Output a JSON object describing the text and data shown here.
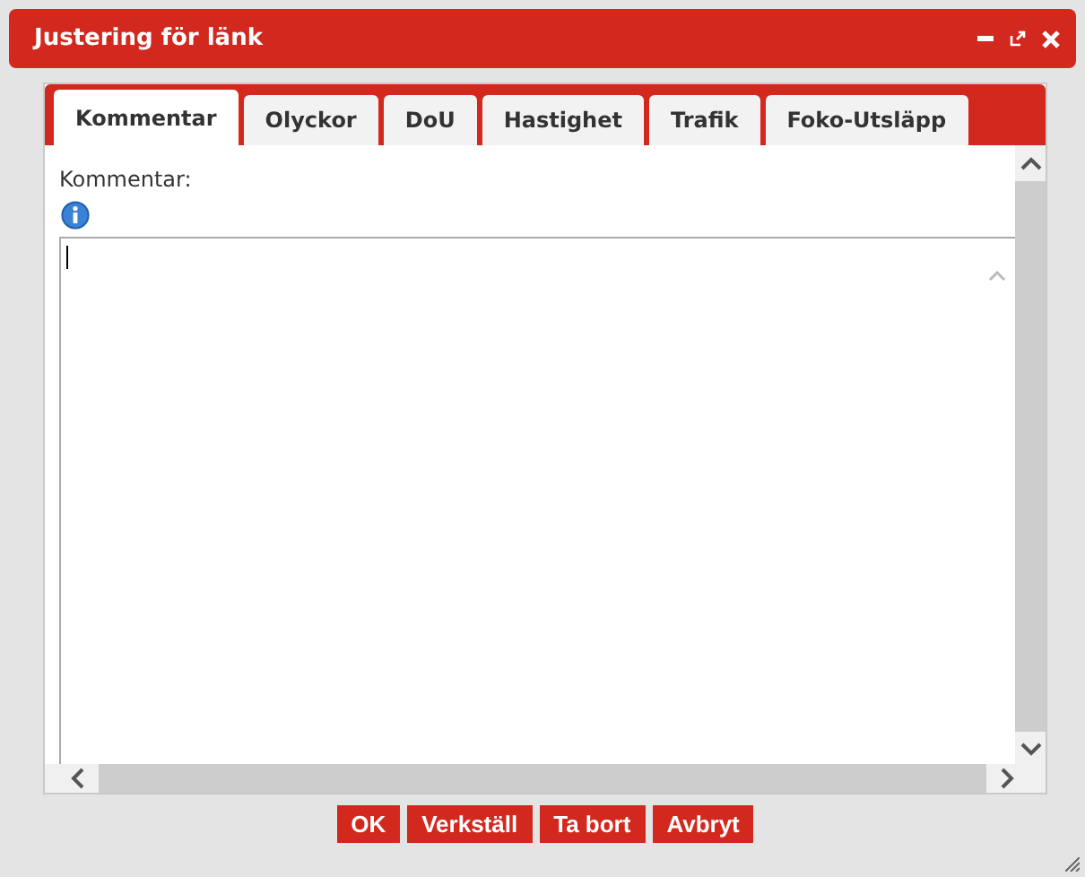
{
  "window": {
    "title": "Justering för länk"
  },
  "tabs": [
    {
      "label": "Kommentar",
      "selected": true
    },
    {
      "label": "Olyckor",
      "selected": false
    },
    {
      "label": "DoU",
      "selected": false
    },
    {
      "label": "Hastighet",
      "selected": false
    },
    {
      "label": "Trafik",
      "selected": false
    },
    {
      "label": "Foko-Utsläpp",
      "selected": false
    }
  ],
  "comment": {
    "label": "Kommentar:"
  },
  "buttons": [
    "OK",
    "Verkställ",
    "Ta bort",
    "Avbryt"
  ]
}
